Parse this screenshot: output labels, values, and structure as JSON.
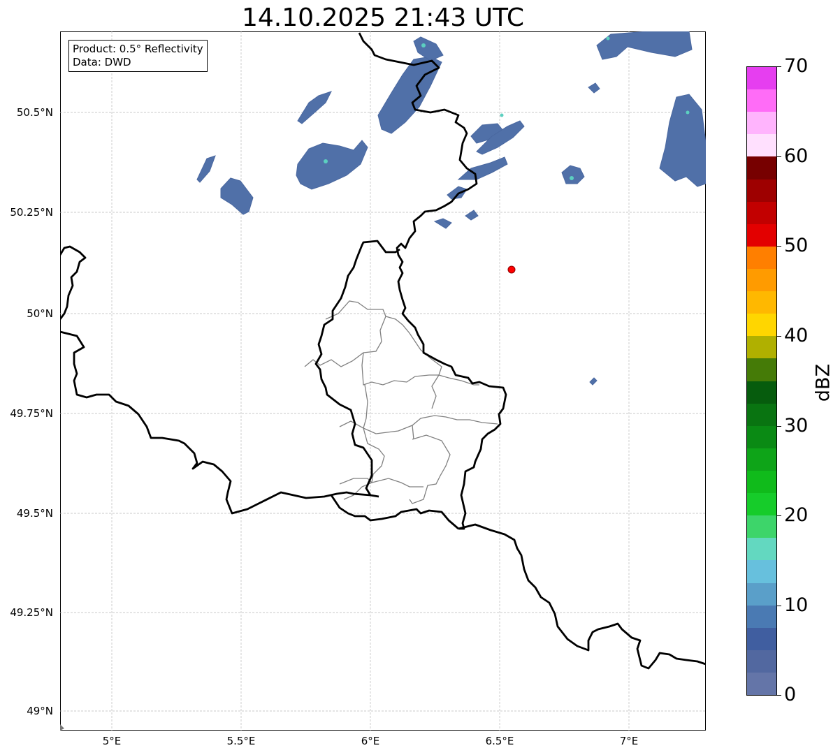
{
  "title": "14.10.2025 21:43 UTC",
  "info": {
    "product": "Product: 0.5° Reflectivity",
    "data_source": "Data: DWD"
  },
  "map": {
    "lon_range": [
      4.8,
      7.3
    ],
    "lat_range": [
      48.95,
      50.7
    ],
    "x_ticks": [
      "5°E",
      "5.5°E",
      "6°E",
      "6.5°E",
      "7°E"
    ],
    "y_ticks": [
      "50.5°N",
      "50.25°N",
      "50°N",
      "49.75°N",
      "49.5°N",
      "49.25°N",
      "49°N"
    ],
    "marker": {
      "lon": 6.548,
      "lat": 50.108,
      "color": "#ff0000"
    },
    "precip_color": "#5070a8",
    "highlight_color": "#5cd0c0"
  },
  "colorbar": {
    "label": "dBZ",
    "tick_labels": [
      "70",
      "60",
      "50",
      "40",
      "30",
      "20",
      "10",
      "0"
    ],
    "range": [
      0,
      70
    ],
    "colors_top_to_bottom": [
      "#e63ef0",
      "#ff6cf7",
      "#ffb4fd",
      "#ffe0fe",
      "#770000",
      "#9e0000",
      "#c20000",
      "#e30000",
      "#ff7f00",
      "#ff9b00",
      "#ffb800",
      "#ffd600",
      "#b0b000",
      "#457b07",
      "#065c0d",
      "#097411",
      "#0a8a14",
      "#0ea418",
      "#10bb1b",
      "#16cc2a",
      "#3dd56a",
      "#63d8c0",
      "#67c0dd",
      "#5a9fc9",
      "#4a7ab3",
      "#405ea0",
      "#5268a0",
      "#6475a8"
    ]
  }
}
